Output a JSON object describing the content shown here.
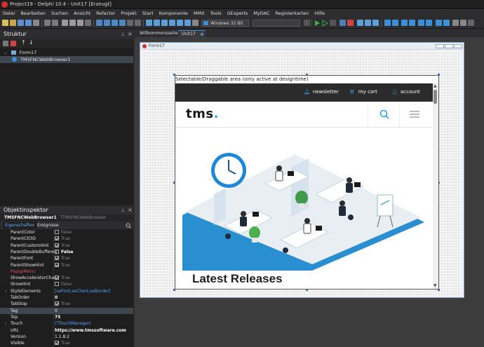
{
  "window": {
    "title": "Project19 - Delphi 10.4 - Unit17 [Erzeugt]"
  },
  "menu": [
    "Datei",
    "Bearbeiten",
    "Suchen",
    "Ansicht",
    "Refactor",
    "Projekt",
    "Start",
    "Komponente",
    "MMX",
    "Tools",
    "GExperts",
    "MyDAC",
    "Registerkarten",
    "Hilfe"
  ],
  "toolbar": {
    "platform": "Windows 32 Bit"
  },
  "structure": {
    "title": "Struktur",
    "nodes": [
      "Form17",
      "TMSFNCWebBrowser1"
    ]
  },
  "inspector": {
    "title": "Objektinspektor",
    "component": "TMSFNCWebBrowser1",
    "component_type": "TTMSFNCWebBrowser",
    "tabs": [
      "Eigenschaften",
      "Ereignisse"
    ],
    "properties": [
      {
        "name": "ParentColor",
        "value": "False",
        "check": false
      },
      {
        "name": "ParentCtl3D",
        "value": "True",
        "check": true
      },
      {
        "name": "ParentCustomHint",
        "value": "True",
        "check": true
      },
      {
        "name": "ParentDoubleBuffered",
        "value": "False",
        "check": false
      },
      {
        "name": "ParentFont",
        "value": "True",
        "check": true
      },
      {
        "name": "ParentShowHint",
        "value": "True",
        "check": true
      },
      {
        "name": "PopupMenu",
        "value": ""
      },
      {
        "name": "ShowAcceleratorChar",
        "value": "True",
        "check": true
      },
      {
        "name": "ShowHint",
        "value": "False",
        "check": false
      },
      {
        "name": "StyleElements",
        "value": "[seFont,seClient,seBorder]"
      },
      {
        "name": "TabOrder",
        "value": "0"
      },
      {
        "name": "TabStop",
        "value": "True",
        "check": true
      },
      {
        "name": "Tag",
        "value": "0"
      },
      {
        "name": "Top",
        "value": "75"
      },
      {
        "name": "Touch",
        "value": "(TTouchManager)"
      },
      {
        "name": "URL",
        "value": "https://www.tmssoftware.com"
      },
      {
        "name": "Version",
        "value": "1.1.8.2"
      },
      {
        "name": "Visible",
        "value": "True",
        "check": true
      }
    ]
  },
  "editor": {
    "tabs": [
      "Willkommensseite",
      "Unit17"
    ],
    "form_title": "Form17"
  },
  "browser": {
    "drag_caption": "Selectable/Draggable area (only active at designtime)",
    "nav": [
      "newsletter",
      "my cart",
      "account"
    ],
    "logo": "tms",
    "heading": "Latest Releases"
  }
}
